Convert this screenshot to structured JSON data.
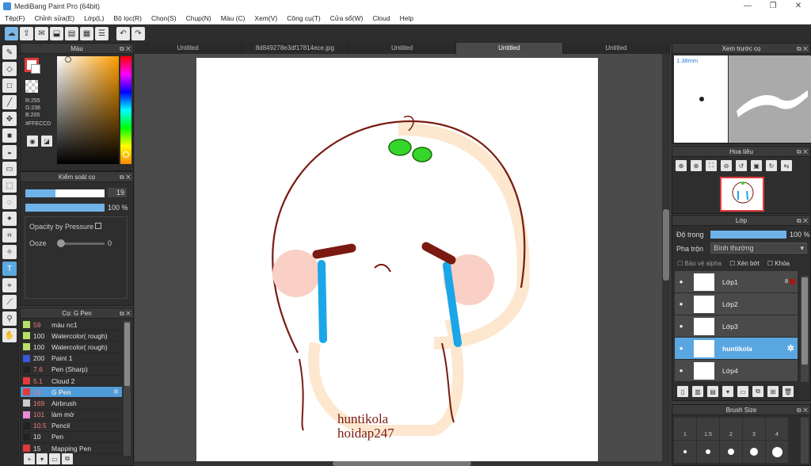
{
  "window": {
    "title": "MediBang Paint Pro (64bit)",
    "minimize": "—",
    "restore": "❐",
    "close": "✕"
  },
  "menu": [
    "Tệp(F)",
    "Chỉnh sửa(E)",
    "Lớp(L)",
    "Bộ lọc(R)",
    "Chọn(S)",
    "Chụp(N)",
    "Màu (C)",
    "Xem(V)",
    "Công cụ(T)",
    "Cửa sổ(W)",
    "Cloud",
    "Help"
  ],
  "tabs": [
    "Untitled",
    "8d849278e3df17814ece.jpg",
    "Untitled",
    "Untitled",
    "Untitled"
  ],
  "color_panel": {
    "title": "Màu",
    "r": "R:255",
    "g": "G:236",
    "b": "B:205",
    "hex": "#FFECCD"
  },
  "brush_control": {
    "title": "Kiểm soát cọ",
    "size": "19",
    "opacity": "100 %",
    "opacity_pressure": "Opacity by Pressure",
    "ooze": "Ooze",
    "ooze_value": "0"
  },
  "brush_list": {
    "title": "Cọ: G Pen",
    "items": [
      {
        "size": "59",
        "name": "màu nc1",
        "color": "#b5e06a"
      },
      {
        "size": "100",
        "name": "Watercolor( rough)",
        "color": "#b5e06a"
      },
      {
        "size": "100",
        "name": "Watercolor( rough)",
        "color": "#b5e06a"
      },
      {
        "size": "200",
        "name": "Paint 1",
        "color": "#3a5ad8"
      },
      {
        "size": "7.6",
        "name": "Pen (Sharp)",
        "color": "#222222"
      },
      {
        "size": "5.1",
        "name": "Cloud 2",
        "color": "#e23b3b"
      },
      {
        "size": "19",
        "name": "G Pen",
        "color": "#e23b3b"
      },
      {
        "size": "169",
        "name": "Airbrush",
        "color": "#cccccc"
      },
      {
        "size": "101",
        "name": "làm mờ",
        "color": "#e88ad8"
      },
      {
        "size": "10.5",
        "name": "Pencil",
        "color": "#222222"
      },
      {
        "size": "10",
        "name": "Pen",
        "color": "#222222"
      },
      {
        "size": "15",
        "name": "Mapping Pen",
        "color": "#e23b3b"
      }
    ]
  },
  "preview_panel": {
    "title": "Xem trước cọ",
    "size_label": "1.38mm"
  },
  "navigator": {
    "title": "Hoa tiêu"
  },
  "layers": {
    "title": "Lớp",
    "opacity_label": "Độ trong",
    "opacity_value": "100 %",
    "blend_label": "Pha trộn",
    "blend_value": "Bình thường",
    "protect_alpha": "Bảo vệ alpha",
    "clipping": "Xén bớt",
    "lock": "Khóa",
    "items": [
      {
        "name": "Lớp1",
        "badge": "8"
      },
      {
        "name": "Lớp2"
      },
      {
        "name": "Lớp3"
      },
      {
        "name": "huntikola"
      },
      {
        "name": "Lớp4"
      }
    ]
  },
  "brush_size": {
    "title": "Brush Size",
    "labels": [
      "1",
      "1.5",
      "2",
      "3",
      "4"
    ]
  },
  "canvas_text": {
    "line1": "huntikola",
    "line2": "hoidap247"
  }
}
